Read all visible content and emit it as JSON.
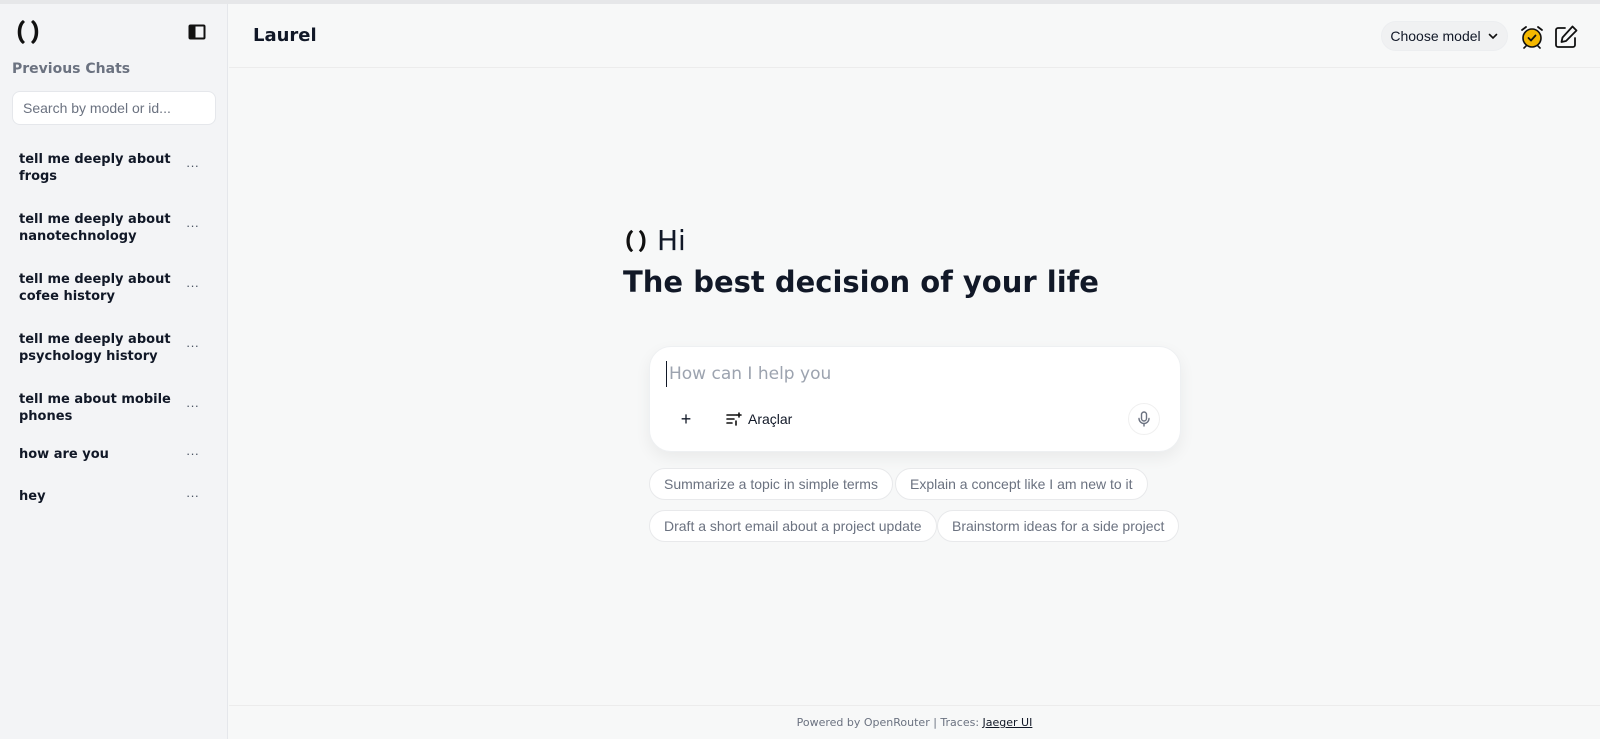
{
  "sidebar": {
    "logo_icon": "laurel-logo-icon",
    "toggle_icon": "sidebar-toggle-icon",
    "previous_chats_label": "Previous Chats",
    "search_placeholder": "Search by model or id...",
    "search_value": "",
    "chats": [
      {
        "label": "tell me deeply about frogs",
        "menu": "···"
      },
      {
        "label": "tell me deeply about nanotechnology",
        "menu": "···"
      },
      {
        "label": "tell me deeply about cofee history",
        "menu": "···"
      },
      {
        "label": "tell me deeply about psychology history",
        "menu": "···"
      },
      {
        "label": "tell me about mobile phones",
        "menu": "···"
      },
      {
        "label": "how are you",
        "menu": "···"
      },
      {
        "label": "hey",
        "menu": "···"
      }
    ]
  },
  "header": {
    "title": "Laurel",
    "model_button": "Choose model",
    "alarm_icon": "alarm-clock-icon",
    "new_chat_icon": "edit-icon"
  },
  "main": {
    "greeting": "Hi",
    "headline": "The best decision of your life",
    "composer": {
      "placeholder": "How can I help you",
      "value": "",
      "plus_label": "+",
      "tools_label": "Araçlar"
    },
    "suggestions": [
      "Summarize a topic in simple terms",
      "Explain a concept like I am new to it",
      "Draft a short email about a project update",
      "Brainstorm ideas for a side project"
    ]
  },
  "footer": {
    "prefix": "Powered by OpenRouter | Traces: ",
    "link": "Jaeger UI"
  },
  "colors": {
    "background": "#f7f8f8",
    "sidebar": "#f3f4f6",
    "text": "#111827",
    "muted": "#6b7280",
    "alarm_accent": "#f5b800"
  }
}
